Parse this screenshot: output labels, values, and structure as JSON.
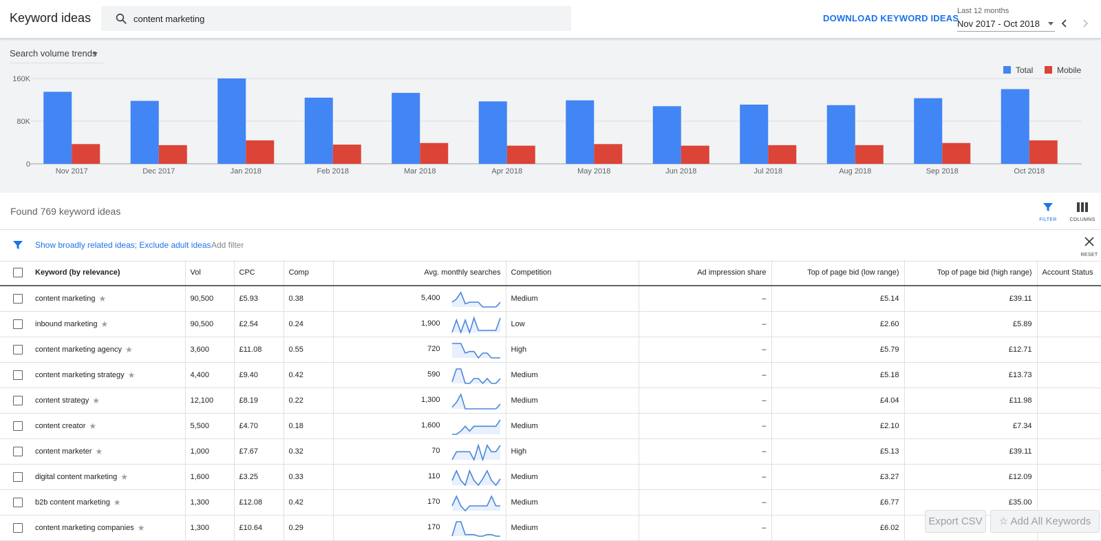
{
  "header": {
    "title": "Keyword ideas",
    "search_value": "content marketing",
    "download_label": "DOWNLOAD KEYWORD IDEAS",
    "range_caption": "Last 12 months",
    "range_value": "Nov 2017 - Oct 2018"
  },
  "chart_panel": {
    "selector_label": "Search volume trends"
  },
  "chart_data": {
    "type": "bar",
    "categories": [
      "Nov 2017",
      "Dec 2017",
      "Jan 2018",
      "Feb 2018",
      "Mar 2018",
      "Apr 2018",
      "May 2018",
      "Jun 2018",
      "Jul 2018",
      "Aug 2018",
      "Sep 2018",
      "Oct 2018"
    ],
    "series": [
      {
        "name": "Total",
        "color": "#4285f4",
        "values": [
          135000,
          118000,
          160000,
          124000,
          133000,
          117000,
          119000,
          108000,
          111000,
          110000,
          123000,
          140000
        ]
      },
      {
        "name": "Mobile",
        "color": "#db4437",
        "values": [
          37000,
          35000,
          44000,
          36000,
          39000,
          34000,
          37000,
          34000,
          35000,
          35000,
          39000,
          44000
        ]
      }
    ],
    "y_ticks": [
      "0",
      "80K",
      "160K"
    ],
    "ylim": [
      0,
      160000
    ],
    "grid": true,
    "legend": "top-right"
  },
  "results": {
    "found_text": "Found 769 keyword ideas",
    "filter_label": "FILTER",
    "columns_label": "COLUMNS",
    "active_filters": "Show broadly related ideas; Exclude adult ideas",
    "add_filter_label": "Add filter",
    "reset_label": "RESET"
  },
  "table": {
    "headers": {
      "keyword": "Keyword (by relevance)",
      "vol": "Vol",
      "cpc": "CPC",
      "comp": "Comp",
      "avg": "Avg. monthly searches",
      "competition": "Competition",
      "ad_share": "Ad impression share",
      "bid_low": "Top of page bid (low range)",
      "bid_high": "Top of page bid (high range)",
      "status": "Account Status"
    },
    "rows": [
      {
        "keyword": "content marketing",
        "vol": "90,500",
        "cpc": "£5.93",
        "comp": "0.38",
        "avg": "5,400",
        "competition": "Medium",
        "ad_share": "–",
        "bid_low": "£5.14",
        "bid_high": "£39.11",
        "spark": [
          4,
          6,
          10,
          3,
          4,
          4,
          4,
          1,
          1,
          1,
          1,
          4
        ]
      },
      {
        "keyword": "inbound marketing",
        "vol": "90,500",
        "cpc": "£2.54",
        "comp": "0.24",
        "avg": "1,900",
        "competition": "Low",
        "ad_share": "–",
        "bid_low": "£2.60",
        "bid_high": "£5.89",
        "spark": [
          2,
          8,
          2,
          8,
          2,
          9,
          3,
          3,
          3,
          3,
          3,
          9
        ]
      },
      {
        "keyword": "content marketing agency",
        "vol": "3,600",
        "cpc": "£11.08",
        "comp": "0.55",
        "avg": "720",
        "competition": "High",
        "ad_share": "–",
        "bid_low": "£5.79",
        "bid_high": "£12.71",
        "spark": [
          10,
          10,
          10,
          4,
          5,
          5,
          1,
          4,
          4,
          1,
          1,
          1
        ]
      },
      {
        "keyword": "content marketing strategy",
        "vol": "4,400",
        "cpc": "£9.40",
        "comp": "0.42",
        "avg": "590",
        "competition": "Medium",
        "ad_share": "–",
        "bid_low": "£5.18",
        "bid_high": "£13.73",
        "spark": [
          2,
          10,
          10,
          1,
          1,
          4,
          4,
          1,
          4,
          1,
          1,
          4
        ]
      },
      {
        "keyword": "content strategy",
        "vol": "12,100",
        "cpc": "£8.19",
        "comp": "0.22",
        "avg": "1,300",
        "competition": "Medium",
        "ad_share": "–",
        "bid_low": "£4.04",
        "bid_high": "£11.98",
        "spark": [
          2,
          5,
          10,
          1,
          1,
          1,
          1,
          1,
          1,
          1,
          1,
          4
        ]
      },
      {
        "keyword": "content creator",
        "vol": "5,500",
        "cpc": "£4.70",
        "comp": "0.18",
        "avg": "1,600",
        "competition": "Medium",
        "ad_share": "–",
        "bid_low": "£2.10",
        "bid_high": "£7.34",
        "spark": [
          1,
          1,
          3,
          6,
          3,
          6,
          6,
          6,
          6,
          6,
          6,
          10
        ]
      },
      {
        "keyword": "content marketer",
        "vol": "1,000",
        "cpc": "£7.67",
        "comp": "0.32",
        "avg": "70",
        "competition": "High",
        "ad_share": "–",
        "bid_low": "£5.13",
        "bid_high": "£39.11",
        "spark": [
          1,
          6,
          6,
          6,
          6,
          1,
          10,
          1,
          10,
          6,
          6,
          10
        ]
      },
      {
        "keyword": "digital content marketing",
        "vol": "1,600",
        "cpc": "£3.25",
        "comp": "0.33",
        "avg": "110",
        "competition": "Medium",
        "ad_share": "–",
        "bid_low": "£3.27",
        "bid_high": "£12.09",
        "spark": [
          4,
          10,
          4,
          1,
          10,
          4,
          1,
          5,
          10,
          4,
          1,
          5
        ]
      },
      {
        "keyword": "b2b content marketing",
        "vol": "1,300",
        "cpc": "£12.08",
        "comp": "0.42",
        "avg": "170",
        "competition": "Medium",
        "ad_share": "–",
        "bid_low": "£6.77",
        "bid_high": "£35.00",
        "spark": [
          4,
          10,
          4,
          1,
          4,
          4,
          4,
          4,
          4,
          10,
          4,
          4
        ]
      },
      {
        "keyword": "content marketing companies",
        "vol": "1,300",
        "cpc": "£10.64",
        "comp": "0.29",
        "avg": "170",
        "competition": "Medium",
        "ad_share": "–",
        "bid_low": "£6.02",
        "bid_high": "",
        "spark": [
          1,
          10,
          10,
          2,
          2,
          2,
          1,
          1,
          2,
          2,
          1,
          1
        ]
      }
    ]
  },
  "floating": {
    "export_label": "Export CSV",
    "add_all_label": "Add All Keywords"
  },
  "colors": {
    "accent": "#1a73e8",
    "total_bar": "#4285f4",
    "mobile_bar": "#db4437"
  }
}
